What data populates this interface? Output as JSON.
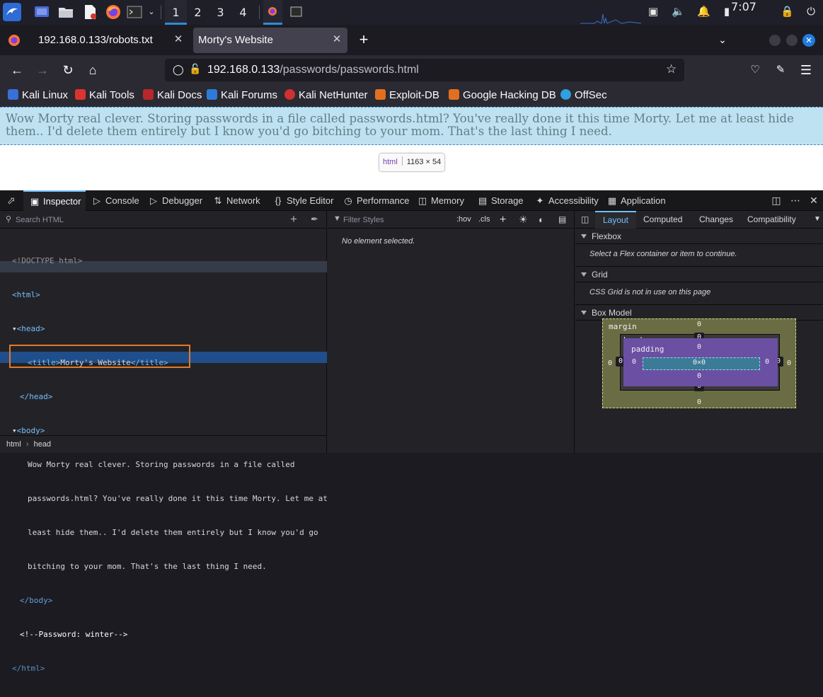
{
  "taskbar": {
    "workspaces": [
      "1",
      "2",
      "3",
      "4"
    ],
    "clock": "7:07"
  },
  "browser": {
    "tabs": [
      {
        "title": "192.168.0.133/robots.txt",
        "active": false
      },
      {
        "title": "Morty's Website",
        "active": true
      }
    ],
    "url_host": "192.168.0.133",
    "url_path": "/passwords/passwords.html",
    "bookmarks": [
      "Kali Linux",
      "Kali Tools",
      "Kali Docs",
      "Kali Forums",
      "Kali NetHunter",
      "Exploit-DB",
      "Google Hacking DB",
      "OffSec"
    ]
  },
  "page": {
    "body_text": "Wow Morty real clever. Storing passwords in a file called passwords.html? You've really done it this time Morty. Let me at least hide them.. I'd delete them entirely but I know you'd go bitching to your mom. That's the last thing I need.",
    "tooltip_tag": "html",
    "tooltip_size": "1163 × 54"
  },
  "devtools": {
    "tabs": [
      "Inspector",
      "Console",
      "Debugger",
      "Network",
      "Style Editor",
      "Performance",
      "Memory",
      "Storage",
      "Accessibility",
      "Application"
    ],
    "search_placeholder": "Search HTML",
    "markup": {
      "doctype": "<!DOCTYPE html>",
      "html_open": "<html>",
      "head_open": "<head>",
      "title_line": "<title>Morty's Website</title>",
      "title_open": "<title>",
      "title_text": "Morty's Website",
      "title_close": "</title>",
      "head_close": "</head>",
      "body_open": "<body>",
      "body_lines": [
        "Wow Morty real clever. Storing passwords in a file called",
        "passwords.html? You've really done it this time Morty. Let me at",
        "least hide them.. I'd delete them entirely but I know you'd go",
        "bitching to your mom. That's the last thing I need."
      ],
      "body_close": "</body>",
      "comment": "<!--Password: winter-->",
      "html_close": "</html>"
    },
    "breadcrumb": [
      "html",
      "head"
    ],
    "rules": {
      "filter_placeholder": "Filter Styles",
      "hov": ":hov",
      "cls": ".cls",
      "empty": "No element selected."
    },
    "layout": {
      "tabs": [
        "Layout",
        "Computed",
        "Changes",
        "Compatibility"
      ],
      "flexbox_title": "Flexbox",
      "flexbox_msg": "Select a Flex container or item to continue.",
      "grid_title": "Grid",
      "grid_msg": "CSS Grid is not in use on this page",
      "boxmodel_title": "Box Model",
      "boxmodel": {
        "margin_label": "margin",
        "border_label": "border",
        "padding_label": "padding",
        "content": "0×0",
        "zero": "0"
      }
    }
  }
}
